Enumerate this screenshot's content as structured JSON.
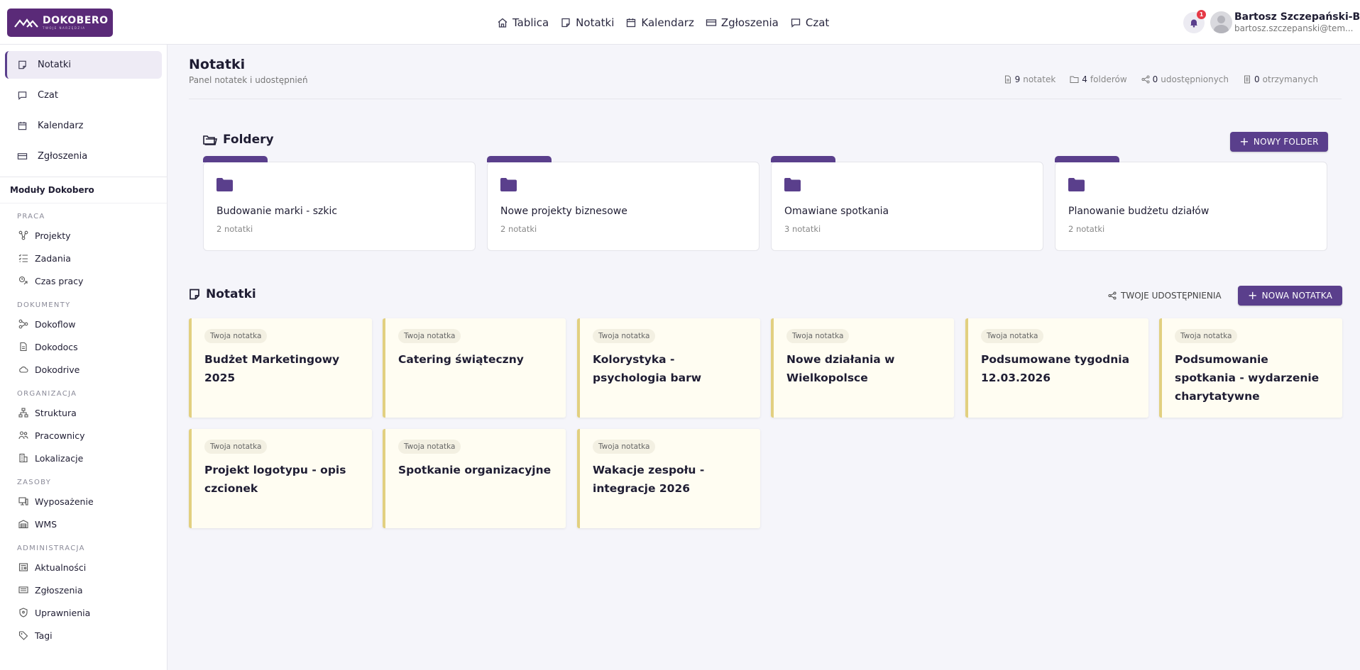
{
  "brand": {
    "name": "DOKOBERO",
    "tagline": "TWOJE NARZĘDZIA",
    "color": "#5a2a78"
  },
  "topnav": [
    {
      "label": "Tablica",
      "icon": "home-icon"
    },
    {
      "label": "Notatki",
      "icon": "note-icon"
    },
    {
      "label": "Kalendarz",
      "icon": "calendar-icon"
    },
    {
      "label": "Zgłoszenia",
      "icon": "ticket-icon"
    },
    {
      "label": "Czat",
      "icon": "chat-icon"
    }
  ],
  "notifications": {
    "count": "1"
  },
  "user": {
    "name": "Bartosz Szczepański-B...",
    "email": "bartosz.szczepanski@tem..."
  },
  "sidebar": {
    "main": [
      {
        "label": "Notatki",
        "icon": "note-icon",
        "active": true
      },
      {
        "label": "Czat",
        "icon": "chat-icon"
      },
      {
        "label": "Kalendarz",
        "icon": "calendar-icon"
      },
      {
        "label": "Zgłoszenia",
        "icon": "ticket-icon"
      }
    ],
    "modules_title": "Moduły Dokobero",
    "sections": [
      {
        "label": "PRACA",
        "items": [
          {
            "label": "Projekty",
            "icon": "projects-icon"
          },
          {
            "label": "Zadania",
            "icon": "tasks-icon"
          },
          {
            "label": "Czas pracy",
            "icon": "worktime-icon"
          }
        ]
      },
      {
        "label": "DOKUMENTY",
        "items": [
          {
            "label": "Dokoflow",
            "icon": "flow-icon"
          },
          {
            "label": "Dokodocs",
            "icon": "document-icon"
          },
          {
            "label": "Dokodrive",
            "icon": "cloud-icon"
          }
        ]
      },
      {
        "label": "ORGANIZACJA",
        "items": [
          {
            "label": "Struktura",
            "icon": "structure-icon"
          },
          {
            "label": "Pracownicy",
            "icon": "people-icon"
          },
          {
            "label": "Lokalizacje",
            "icon": "building-icon"
          }
        ]
      },
      {
        "label": "ZASOBY",
        "items": [
          {
            "label": "Wyposażenie",
            "icon": "equipment-icon"
          },
          {
            "label": "WMS",
            "icon": "warehouse-icon"
          }
        ]
      },
      {
        "label": "ADMINISTRACJA",
        "items": [
          {
            "label": "Aktualności",
            "icon": "news-icon"
          },
          {
            "label": "Zgłoszenia",
            "icon": "ticket-icon"
          },
          {
            "label": "Uprawnienia",
            "icon": "shield-icon"
          },
          {
            "label": "Tagi",
            "icon": "tag-icon"
          }
        ]
      }
    ]
  },
  "page": {
    "title": "Notatki",
    "subtitle": "Panel notatek i udostępnień",
    "stats": [
      {
        "value": "9",
        "label": "notatek",
        "icon": "document-icon"
      },
      {
        "value": "4",
        "label": "folderów",
        "icon": "folder-icon"
      },
      {
        "value": "0",
        "label": "udostępnionych",
        "icon": "share-icon"
      },
      {
        "value": "0",
        "label": "otrzymanych",
        "icon": "received-icon"
      }
    ]
  },
  "folders_section": {
    "title": "Foldery",
    "new_button": "NOWY FOLDER",
    "items": [
      {
        "name": "Budowanie marki - szkic",
        "count": "2 notatki"
      },
      {
        "name": "Nowe projekty biznesowe",
        "count": "2 notatki"
      },
      {
        "name": "Omawiane spotkania",
        "count": "3 notatki"
      },
      {
        "name": "Planowanie budżetu działów",
        "count": "2 notatki"
      }
    ]
  },
  "notes_section": {
    "title": "Notatki",
    "shares_button": "TWOJE UDOSTĘPNIENIA",
    "new_button": "NOWA NOTATKA",
    "items": [
      {
        "badge": "Twoja notatka",
        "title": "Budżet Marketingowy 2025"
      },
      {
        "badge": "Twoja notatka",
        "title": "Catering świąteczny"
      },
      {
        "badge": "Twoja notatka",
        "title": "Kolorystyka - psychologia barw"
      },
      {
        "badge": "Twoja notatka",
        "title": "Nowe działania w Wielkopolsce"
      },
      {
        "badge": "Twoja notatka",
        "title": "Podsumowane tygodnia 12.03.2026"
      },
      {
        "badge": "Twoja notatka",
        "title": "Podsumowanie spotkania - wydarzenie charytatywne"
      },
      {
        "badge": "Twoja notatka",
        "title": "Projekt logotypu - opis czcionek"
      },
      {
        "badge": "Twoja notatka",
        "title": "Spotkanie organizacyjne"
      },
      {
        "badge": "Twoja notatka",
        "title": "Wakacje zespołu - integracje 2026"
      }
    ]
  }
}
